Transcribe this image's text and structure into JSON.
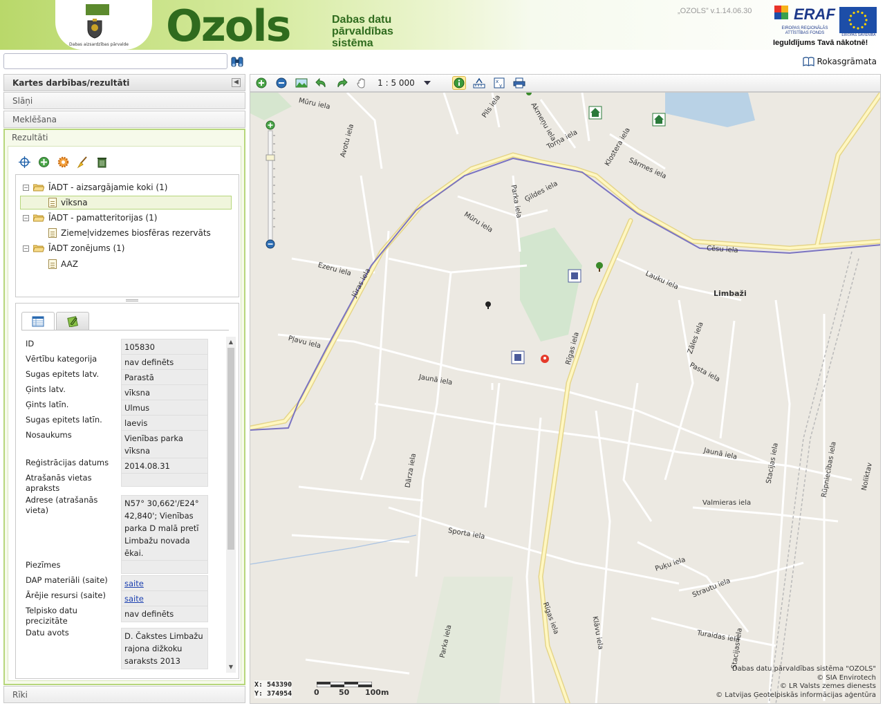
{
  "header": {
    "crest_text": "Dabas aizsardzības pārvalde",
    "logo": "Ozols",
    "subtitle_lines": [
      "Dabas datu",
      "pārvaldības",
      "sistēma"
    ],
    "version": "„OZOLS” v.1.14.06.30",
    "eraf_title": "ERAF",
    "eraf_sub": "EIROPAS REĢIONĀLĀS ATTĪSTĪBAS FONDS",
    "eu_sub": "EIROPAS SAVIENĪBA",
    "slogan": "Ieguldījums Tavā nākotnē!"
  },
  "search": {
    "value": "",
    "placeholder": ""
  },
  "manual_label": "Rokasgrāmata",
  "left_panel": {
    "main_title": "Kartes darbības/rezultāti",
    "layers_label": "Slāņi",
    "search_label": "Meklēšana",
    "results_label": "Rezultāti",
    "tools_label": "Rīki"
  },
  "tree": [
    {
      "label": "ĪADT - aizsargājamie koki (1)",
      "type": "folder"
    },
    {
      "label": "vīksna",
      "type": "doc"
    },
    {
      "label": "ĪADT - pamatteritorijas (1)",
      "type": "folder"
    },
    {
      "label": "Ziemeļvidzemes biosfēras rezervāts",
      "type": "doc"
    },
    {
      "label": "ĪADT zonējums (1)",
      "type": "folder"
    },
    {
      "label": "AAZ",
      "type": "doc"
    }
  ],
  "attributes": [
    {
      "label": "ID",
      "value": "105830"
    },
    {
      "label": "Vērtību kategorija",
      "value": "nav definēts"
    },
    {
      "label": "Sugas epitets latv.",
      "value": "Parastā"
    },
    {
      "label": "Ģints latv.",
      "value": "vīksna"
    },
    {
      "label": "Ģints latīn.",
      "value": "Ulmus"
    },
    {
      "label": "Sugas epitets latīn.",
      "value": "laevis"
    },
    {
      "label": "Nosaukums",
      "value": "Vienības parka vīksna"
    },
    {
      "label": "Reģistrācijas datums",
      "value": "2014.08.31"
    },
    {
      "label": "Atrašanās vietas apraksts",
      "value": ""
    },
    {
      "label": "Adrese (atrašanās vieta)",
      "value": "N57° 30,662'/E24° 42,840'; Vienības parka D malā pretī Limbažu novada ēkai."
    },
    {
      "label": "Piezīmes",
      "value": ""
    },
    {
      "label": "DAP materiāli (saite)",
      "value": "saite"
    },
    {
      "label": "Ārējie resursi (saite)",
      "value": "saite"
    },
    {
      "label": "Telpisko datu precizitāte",
      "value": "nav definēts"
    },
    {
      "label": "Datu avots",
      "value": "D. Čakstes Limbažu rajona dižkoku saraksts 2013"
    }
  ],
  "map_toolbar": {
    "scale": "1 : 5 000"
  },
  "map": {
    "streets": [
      "Mūru iela",
      "Pils iela",
      "Akmeņu iela",
      "Torņa iela",
      "Klostera iela",
      "Sārmes iela",
      "Avotu iela",
      "Parka iela",
      "Ģildes iela",
      "Mūru iela",
      "Cēsu iela",
      "Ezeru iela",
      "Jūras iela",
      "Lauku iela",
      "Pļavu iela",
      "Rīgas iela",
      "Zāles iela",
      "Pasta iela",
      "Jaunā iela",
      "Jaunā iela",
      "Dārza iela",
      "Stacijas iela",
      "Rūpniecības iela",
      "Valmieras iela",
      "Sporta iela",
      "Puķu iela",
      "Strautu iela",
      "Rīgas iela",
      "Klāvu iela",
      "Turaidas iela",
      "Parka iela",
      "Stacijas iela",
      "Noliktav"
    ],
    "town": "Limbaži",
    "coord_x": "X: 543390",
    "coord_y": "Y: 374954",
    "scale_ticks": [
      "0",
      "50",
      "100m"
    ],
    "copyright": [
      "Dabas datu pārvaldības sistēma \"OZOLS\"",
      "© SIA Envirotech",
      "© LR Valsts zemes dienests",
      "© Latvijas Ģeotelpiskās informācijas aģentūra"
    ]
  }
}
